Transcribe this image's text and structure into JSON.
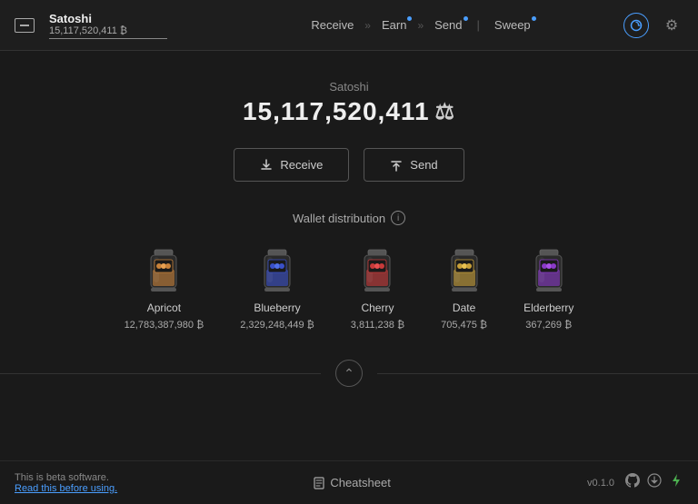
{
  "topnav": {
    "wallet_icon_label": "wallet",
    "wallet_name": "Satoshi",
    "wallet_balance": "15,117,520,411 ₿",
    "nav_items": [
      {
        "label": "Receive",
        "id": "receive",
        "has_dot": false
      },
      {
        "sep": "»"
      },
      {
        "label": "Earn",
        "id": "earn",
        "has_dot": true
      },
      {
        "sep": "»"
      },
      {
        "label": "Send",
        "id": "send",
        "has_dot": true
      },
      {
        "pipe": "|"
      },
      {
        "label": "Sweep",
        "id": "sweep",
        "has_dot": true
      }
    ]
  },
  "main": {
    "account_label": "Satoshi",
    "balance_value": "15,117,520,411",
    "balance_symbol": "₿",
    "receive_btn": "Receive",
    "send_btn": "Send",
    "distribution_label": "Wallet distribution"
  },
  "jars": [
    {
      "name": "Apricot",
      "balance": "12,783,387,980",
      "color": "#c8823a",
      "color2": "#e8a050"
    },
    {
      "name": "Blueberry",
      "balance": "2,329,248,449",
      "color": "#3a50c8",
      "color2": "#5070e8"
    },
    {
      "name": "Cherry",
      "balance": "3,811,238",
      "color": "#c83a3a",
      "color2": "#e85050"
    },
    {
      "name": "Date",
      "balance": "705,475",
      "color": "#c8a03a",
      "color2": "#e8c050"
    },
    {
      "name": "Elderberry",
      "balance": "367,269",
      "color": "#8a3ac8",
      "color2": "#aa50e8"
    }
  ],
  "footer": {
    "beta_text": "This is beta software.",
    "beta_link": "Read this before using.",
    "cheatsheet_label": "Cheatsheet",
    "version": "v0.1.0"
  }
}
